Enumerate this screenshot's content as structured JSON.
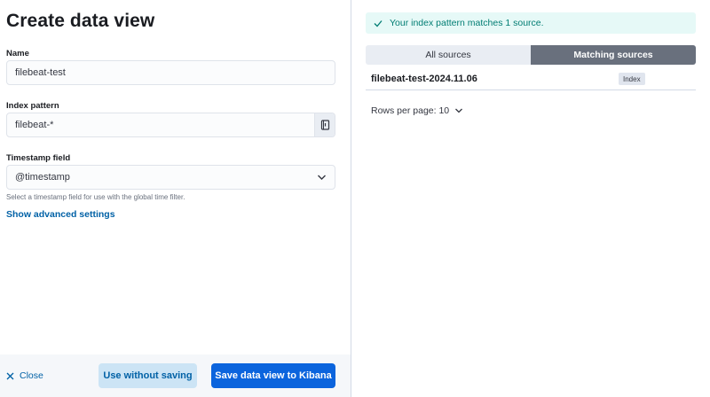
{
  "form": {
    "title": "Create data view",
    "name_label": "Name",
    "name_value": "filebeat-test",
    "index_label": "Index pattern",
    "index_value": "filebeat-*",
    "timestamp_label": "Timestamp field",
    "timestamp_value": "@timestamp",
    "timestamp_help": "Select a timestamp field for use with the global time filter.",
    "advanced_link": "Show advanced settings"
  },
  "footer": {
    "close_label": "Close",
    "use_without_saving_label": "Use without saving",
    "save_label": "Save data view to Kibana"
  },
  "sources": {
    "callout_text": "Your index pattern matches 1 source.",
    "tabs": [
      {
        "label": "All sources",
        "active": false
      },
      {
        "label": "Matching sources",
        "active": true
      }
    ],
    "rows": [
      {
        "name": "filebeat-test-2024.11.06",
        "type": "Index"
      }
    ],
    "rows_per_page_label": "Rows per page: 10"
  },
  "colors": {
    "primary": "#0b64dd",
    "link": "#0061a6",
    "success": "#017d73",
    "tab_active": "#69707d"
  },
  "icons": {
    "callout": "check-icon",
    "index_append": "book-icon",
    "select": "chevron-down-icon",
    "close": "close-icon"
  }
}
